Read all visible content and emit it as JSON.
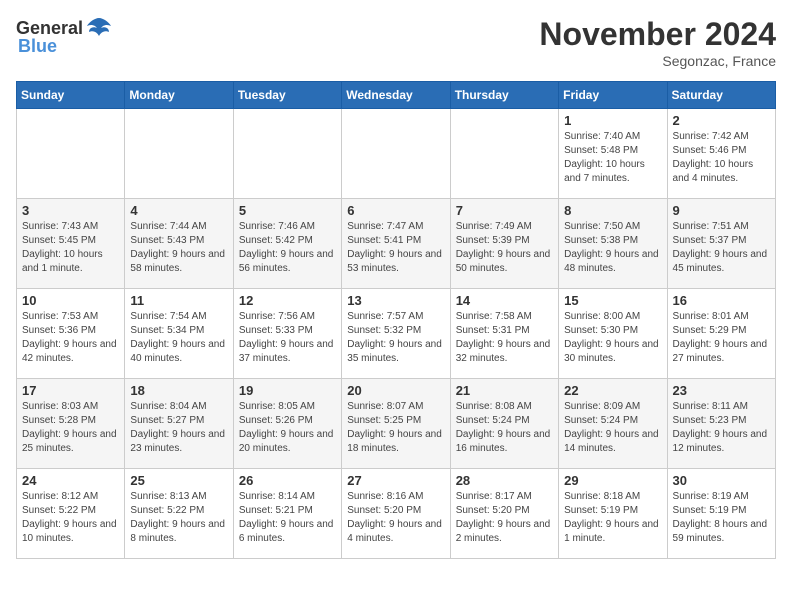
{
  "header": {
    "logo_general": "General",
    "logo_blue": "Blue",
    "month_title": "November 2024",
    "location": "Segonzac, France"
  },
  "days_of_week": [
    "Sunday",
    "Monday",
    "Tuesday",
    "Wednesday",
    "Thursday",
    "Friday",
    "Saturday"
  ],
  "weeks": [
    [
      {
        "day": "",
        "info": ""
      },
      {
        "day": "",
        "info": ""
      },
      {
        "day": "",
        "info": ""
      },
      {
        "day": "",
        "info": ""
      },
      {
        "day": "",
        "info": ""
      },
      {
        "day": "1",
        "info": "Sunrise: 7:40 AM\nSunset: 5:48 PM\nDaylight: 10 hours and 7 minutes."
      },
      {
        "day": "2",
        "info": "Sunrise: 7:42 AM\nSunset: 5:46 PM\nDaylight: 10 hours and 4 minutes."
      }
    ],
    [
      {
        "day": "3",
        "info": "Sunrise: 7:43 AM\nSunset: 5:45 PM\nDaylight: 10 hours and 1 minute."
      },
      {
        "day": "4",
        "info": "Sunrise: 7:44 AM\nSunset: 5:43 PM\nDaylight: 9 hours and 58 minutes."
      },
      {
        "day": "5",
        "info": "Sunrise: 7:46 AM\nSunset: 5:42 PM\nDaylight: 9 hours and 56 minutes."
      },
      {
        "day": "6",
        "info": "Sunrise: 7:47 AM\nSunset: 5:41 PM\nDaylight: 9 hours and 53 minutes."
      },
      {
        "day": "7",
        "info": "Sunrise: 7:49 AM\nSunset: 5:39 PM\nDaylight: 9 hours and 50 minutes."
      },
      {
        "day": "8",
        "info": "Sunrise: 7:50 AM\nSunset: 5:38 PM\nDaylight: 9 hours and 48 minutes."
      },
      {
        "day": "9",
        "info": "Sunrise: 7:51 AM\nSunset: 5:37 PM\nDaylight: 9 hours and 45 minutes."
      }
    ],
    [
      {
        "day": "10",
        "info": "Sunrise: 7:53 AM\nSunset: 5:36 PM\nDaylight: 9 hours and 42 minutes."
      },
      {
        "day": "11",
        "info": "Sunrise: 7:54 AM\nSunset: 5:34 PM\nDaylight: 9 hours and 40 minutes."
      },
      {
        "day": "12",
        "info": "Sunrise: 7:56 AM\nSunset: 5:33 PM\nDaylight: 9 hours and 37 minutes."
      },
      {
        "day": "13",
        "info": "Sunrise: 7:57 AM\nSunset: 5:32 PM\nDaylight: 9 hours and 35 minutes."
      },
      {
        "day": "14",
        "info": "Sunrise: 7:58 AM\nSunset: 5:31 PM\nDaylight: 9 hours and 32 minutes."
      },
      {
        "day": "15",
        "info": "Sunrise: 8:00 AM\nSunset: 5:30 PM\nDaylight: 9 hours and 30 minutes."
      },
      {
        "day": "16",
        "info": "Sunrise: 8:01 AM\nSunset: 5:29 PM\nDaylight: 9 hours and 27 minutes."
      }
    ],
    [
      {
        "day": "17",
        "info": "Sunrise: 8:03 AM\nSunset: 5:28 PM\nDaylight: 9 hours and 25 minutes."
      },
      {
        "day": "18",
        "info": "Sunrise: 8:04 AM\nSunset: 5:27 PM\nDaylight: 9 hours and 23 minutes."
      },
      {
        "day": "19",
        "info": "Sunrise: 8:05 AM\nSunset: 5:26 PM\nDaylight: 9 hours and 20 minutes."
      },
      {
        "day": "20",
        "info": "Sunrise: 8:07 AM\nSunset: 5:25 PM\nDaylight: 9 hours and 18 minutes."
      },
      {
        "day": "21",
        "info": "Sunrise: 8:08 AM\nSunset: 5:24 PM\nDaylight: 9 hours and 16 minutes."
      },
      {
        "day": "22",
        "info": "Sunrise: 8:09 AM\nSunset: 5:24 PM\nDaylight: 9 hours and 14 minutes."
      },
      {
        "day": "23",
        "info": "Sunrise: 8:11 AM\nSunset: 5:23 PM\nDaylight: 9 hours and 12 minutes."
      }
    ],
    [
      {
        "day": "24",
        "info": "Sunrise: 8:12 AM\nSunset: 5:22 PM\nDaylight: 9 hours and 10 minutes."
      },
      {
        "day": "25",
        "info": "Sunrise: 8:13 AM\nSunset: 5:22 PM\nDaylight: 9 hours and 8 minutes."
      },
      {
        "day": "26",
        "info": "Sunrise: 8:14 AM\nSunset: 5:21 PM\nDaylight: 9 hours and 6 minutes."
      },
      {
        "day": "27",
        "info": "Sunrise: 8:16 AM\nSunset: 5:20 PM\nDaylight: 9 hours and 4 minutes."
      },
      {
        "day": "28",
        "info": "Sunrise: 8:17 AM\nSunset: 5:20 PM\nDaylight: 9 hours and 2 minutes."
      },
      {
        "day": "29",
        "info": "Sunrise: 8:18 AM\nSunset: 5:19 PM\nDaylight: 9 hours and 1 minute."
      },
      {
        "day": "30",
        "info": "Sunrise: 8:19 AM\nSunset: 5:19 PM\nDaylight: 8 hours and 59 minutes."
      }
    ]
  ]
}
